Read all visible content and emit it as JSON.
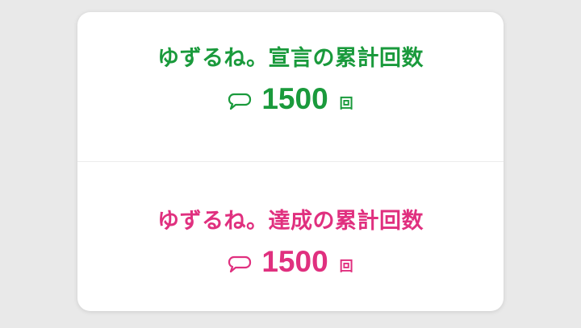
{
  "colors": {
    "declaration": "#1a9a3c",
    "achievement": "#e0307f",
    "background": "#e9e9e9",
    "card": "#ffffff"
  },
  "declaration": {
    "title": "ゆずるね。宣言の累計回数",
    "count": "1500",
    "unit": "回",
    "icon": "speech-bubble-icon"
  },
  "achievement": {
    "title": "ゆずるね。達成の累計回数",
    "count": "1500",
    "unit": "回",
    "icon": "speech-bubble-icon"
  }
}
